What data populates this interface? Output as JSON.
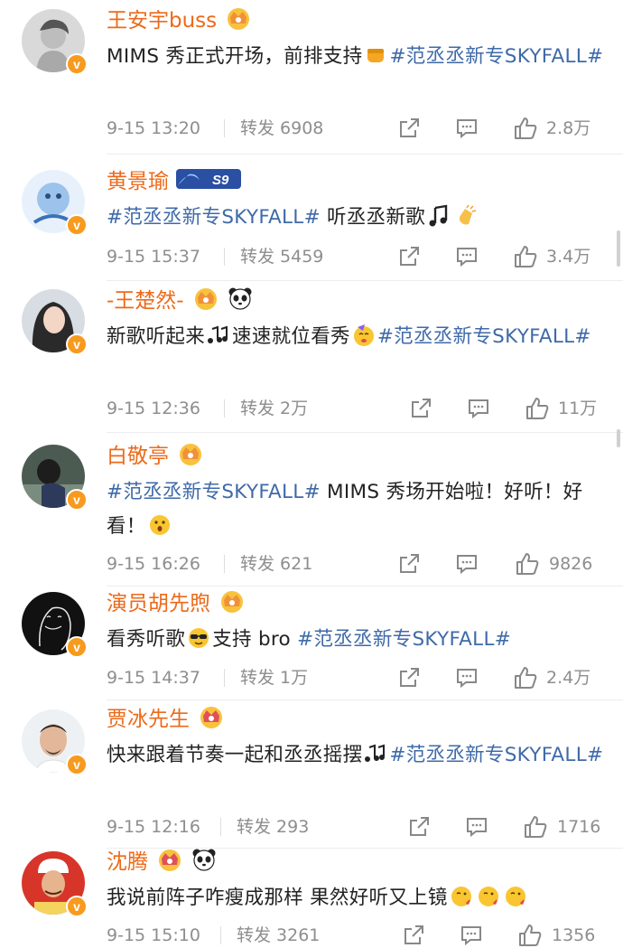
{
  "posts": [
    {
      "name": "王安宇buss",
      "content_a": "MIMS 秀正式开场，前排支持",
      "content_tag": "#范丞丞新专SKYFALL#",
      "content_b": "",
      "time": "9-15 13:20",
      "forward": "转发 6908",
      "likes": "2.8万",
      "badges": [
        "crown-icon"
      ]
    },
    {
      "name": "黄景瑜",
      "content_a": "",
      "content_tag": "#范丞丞新专SKYFALL#",
      "content_b": " 听丞丞新歌",
      "time": "9-15 15:37",
      "forward": "转发 5459",
      "likes": "3.4万",
      "badges": [
        "s9-badge-icon"
      ]
    },
    {
      "name": "-王楚然-",
      "content_a": "新歌听起来",
      "content_a2": "速速就位看秀",
      "content_tag": "#范丞丞新专SKYFALL#",
      "content_b": "",
      "time": "9-15 12:36",
      "forward": "转发 2万",
      "likes": "11万",
      "badges": [
        "crown-icon",
        "panda-icon"
      ]
    },
    {
      "name": "白敬亭",
      "content_a": "",
      "content_tag": "#范丞丞新专SKYFALL#",
      "content_b": " MIMS 秀场开始啦！好听！好看！",
      "time": "9-15 16:26",
      "forward": "转发 621",
      "likes": "9826",
      "badges": [
        "crown-icon"
      ]
    },
    {
      "name": "演员胡先煦",
      "content_a": "看秀听歌",
      "content_a2": "支持 bro ",
      "content_tag": "#范丞丞新专SKYFALL#",
      "content_b": "",
      "time": "9-15 14:37",
      "forward": "转发 1万",
      "likes": "2.4万",
      "badges": [
        "crown-icon"
      ]
    },
    {
      "name": "贾冰先生",
      "content_a": "快来跟着节奏一起和丞丞摇摆",
      "content_tag": "#范丞丞新专SKYFALL#",
      "content_b": "",
      "time": "9-15 12:16",
      "forward": "转发 293",
      "likes": "1716",
      "badges": [
        "crown-icon"
      ]
    },
    {
      "name": "沈腾",
      "content_a": "我说前阵子咋瘦成那样 果然好听又上镜",
      "content_tag": "",
      "content_b": "",
      "time": "9-15 15:10",
      "forward": "转发 3261",
      "likes": "1356",
      "badges": [
        "crown-icon",
        "panda-icon"
      ]
    }
  ],
  "colors": {
    "name": "#ec6a1a",
    "tag": "#3f6aa8",
    "meta": "#8e8e8e",
    "verified": "#f79a1e"
  },
  "verified_mark": "v"
}
